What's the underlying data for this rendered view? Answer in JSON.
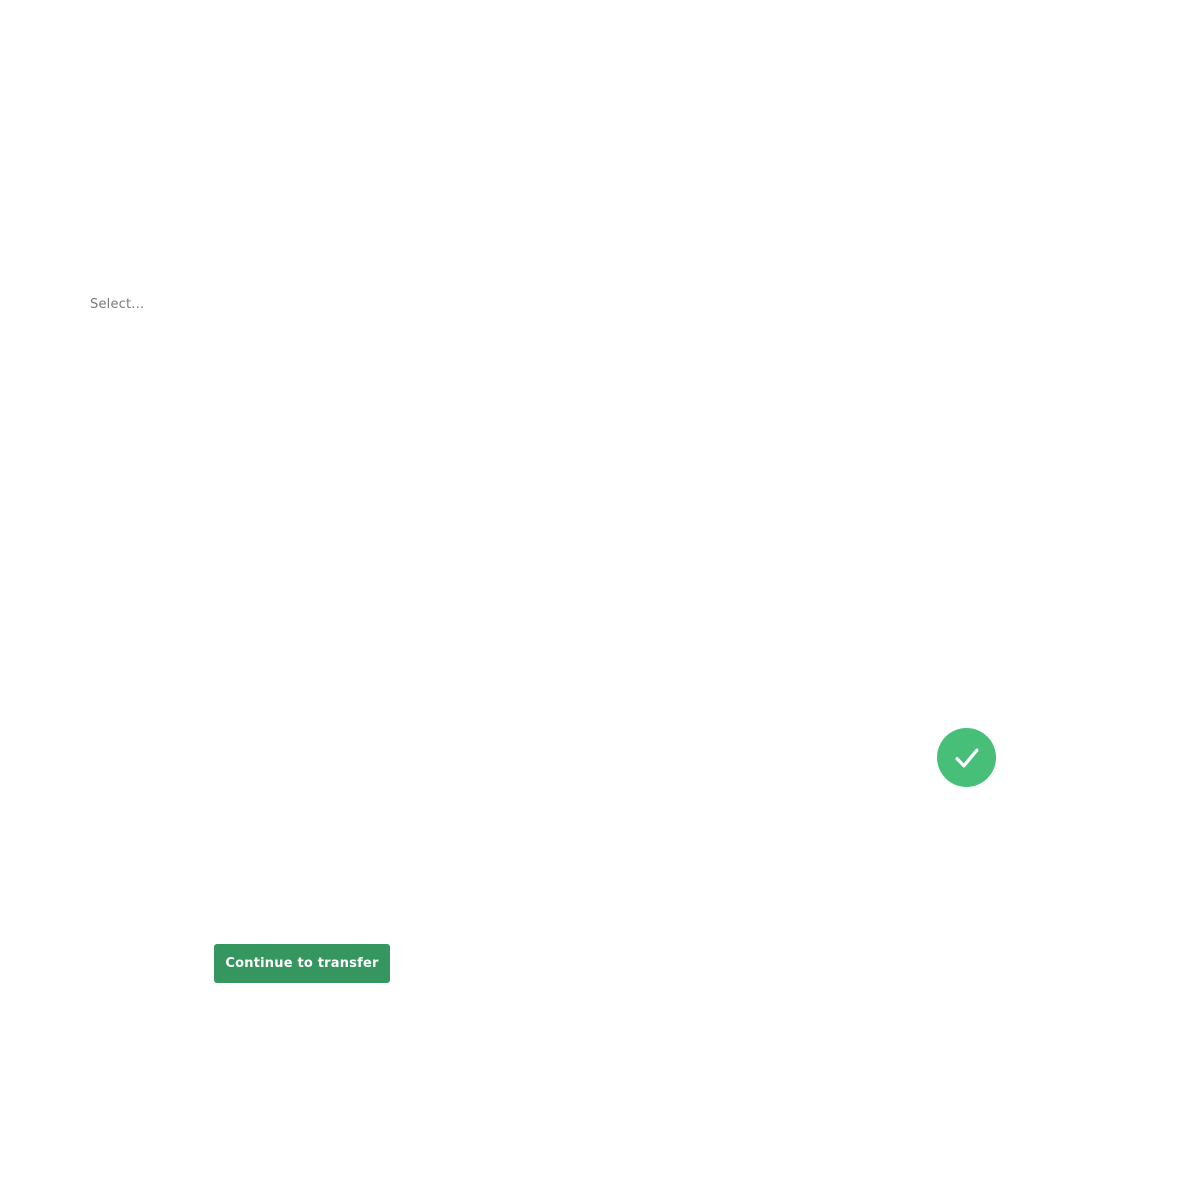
{
  "form": {
    "select": {
      "placeholder": "Select...",
      "value": ""
    },
    "status": {
      "icon": "check-circle-icon",
      "state": "success",
      "color": "#48bf78"
    },
    "continue_button": {
      "label": "Continue to transfer",
      "color": "#36965f"
    }
  }
}
